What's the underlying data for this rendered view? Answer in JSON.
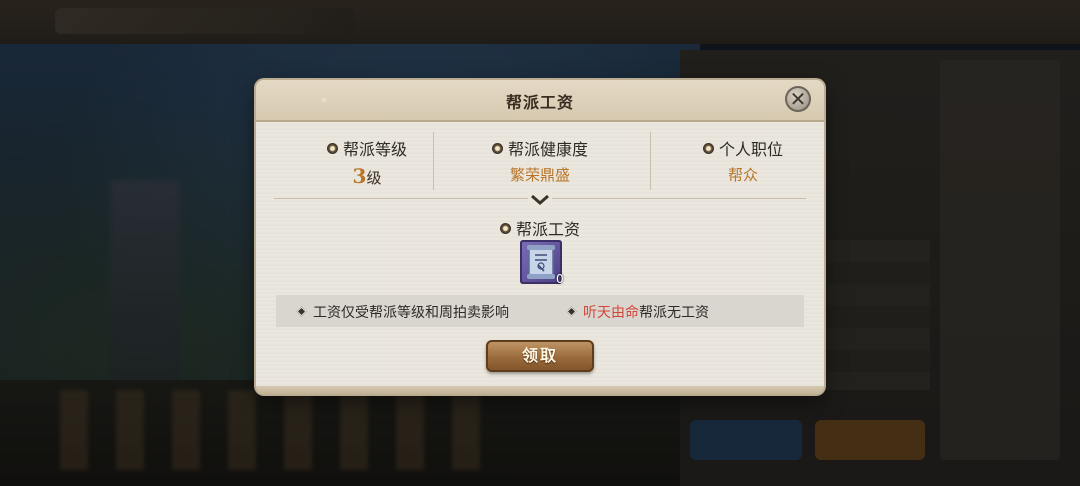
{
  "dialog": {
    "title": "帮派工资",
    "close_symbol": "✕"
  },
  "stats": {
    "level": {
      "label": "帮派等级",
      "value": "3",
      "unit": "级"
    },
    "health": {
      "label": "帮派健康度",
      "value": "繁荣鼎盛"
    },
    "position": {
      "label": "个人职位",
      "value": "帮众"
    }
  },
  "salary": {
    "label": "帮派工资",
    "item_icon": "scroll-icon",
    "item_count": "0"
  },
  "notes": {
    "left": "工资仅受帮派等级和周拍卖影响",
    "right_highlight": "听天由命",
    "right_rest": "帮派无工资"
  },
  "claim_button": {
    "label": "领取"
  },
  "colors": {
    "value_gold": "#b8762a",
    "highlight_red": "#d2463a",
    "item_purple": "#6b5ea8"
  }
}
